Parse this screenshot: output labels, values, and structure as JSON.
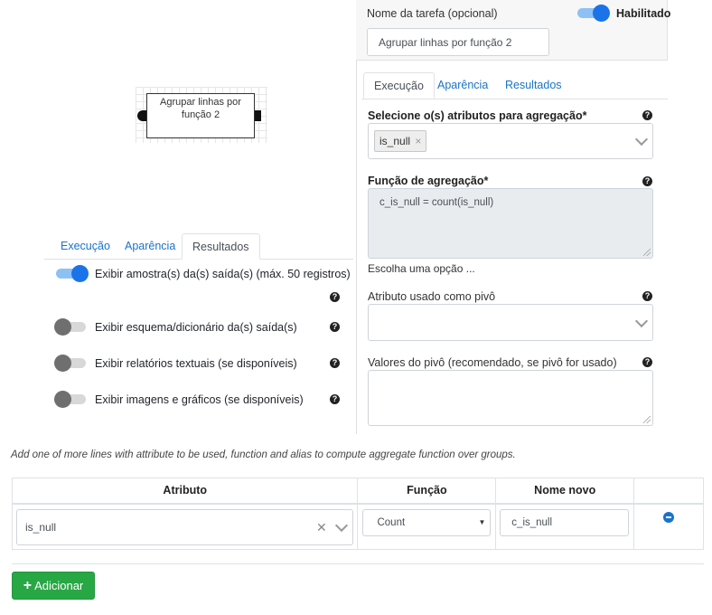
{
  "node": {
    "title": "Agrupar linhas por função 2"
  },
  "left_tabs": [
    {
      "label": "Execução"
    },
    {
      "label": "Aparência"
    },
    {
      "label": "Resultados",
      "active": true
    }
  ],
  "result_options": [
    {
      "label": "Exibir amostra(s) da(s) saída(s) (máx. 50 registros)",
      "enabled": true
    },
    {
      "label": "Exibir esquema/dicionário da(s) saída(s)",
      "enabled": false
    },
    {
      "label": "Exibir relatórios textuais (se disponíveis)",
      "enabled": false
    },
    {
      "label": "Exibir imagens e gráficos (se disponíveis)",
      "enabled": false
    }
  ],
  "task": {
    "name_label": "Nome da tarefa (opcional)",
    "name_value": "Agrupar linhas por função 2",
    "enabled_label": "Habilitado",
    "enabled": true
  },
  "right_tabs": [
    {
      "label": "Execução",
      "active": true
    },
    {
      "label": "Aparência"
    },
    {
      "label": "Resultados"
    }
  ],
  "form": {
    "attributes_label": "Selecione o(s) atributos para agregação*",
    "attributes_selected": [
      "is_null"
    ],
    "chip_remove": "×",
    "function_label": "Função de agregação*",
    "function_value": "c_is_null = count(is_null)",
    "choose_option_link": "Escolha uma opção ...",
    "pivot_label": "Atributo usado como pivô",
    "pivot_values_label": "Valores do pivô (recomendado, se pivô for usado)",
    "help_icon": "?"
  },
  "hint": "Add one of more lines with attribute to be used, function and alias to compute aggregate function over groups.",
  "table": {
    "headers": [
      "Atributo",
      "Função",
      "Nome novo",
      ""
    ],
    "rows": [
      {
        "attribute": "is_null",
        "function": "Count",
        "new_name": "c_is_null"
      }
    ],
    "clear_glyph": "✕",
    "select_arrow": "▼"
  },
  "add_button": {
    "plus": "+",
    "label": "Adicionar"
  },
  "colors": {
    "primary": "#1a73c8",
    "success": "#28a745",
    "toggle_on": "#1a73e8"
  }
}
